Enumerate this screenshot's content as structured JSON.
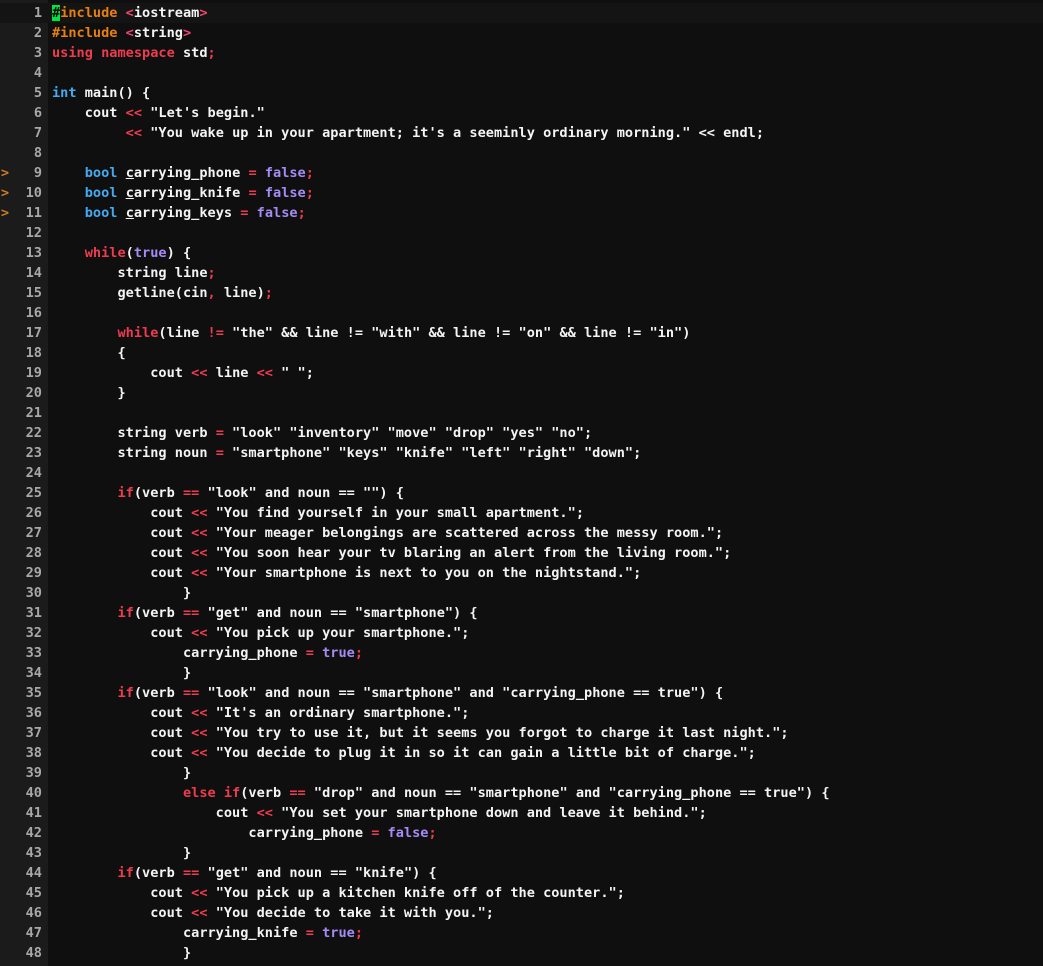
{
  "editor": {
    "colors": {
      "background": "#0f0f0f",
      "gutter": "#1b1b1b",
      "preprocessor": "#e8800f",
      "keyword": "#ee3c4f",
      "type": "#45a9f0",
      "boolean": "#a58bf5",
      "text": "#f4f4f4",
      "cursor": "#00e640"
    },
    "lines": [
      {
        "num": "1",
        "marker": "",
        "current": true,
        "tokens": [
          {
            "c": "cursor-block",
            "t": "#"
          },
          {
            "c": "pre",
            "t": "include "
          },
          {
            "c": "brk",
            "t": "<"
          },
          {
            "c": "plain",
            "t": "iostream"
          },
          {
            "c": "brk",
            "t": ">"
          }
        ]
      },
      {
        "num": "2",
        "marker": "",
        "tokens": [
          {
            "c": "pre",
            "t": "#include "
          },
          {
            "c": "brk",
            "t": "<"
          },
          {
            "c": "plain",
            "t": "string"
          },
          {
            "c": "brk",
            "t": ">"
          }
        ]
      },
      {
        "num": "3",
        "marker": "",
        "tokens": [
          {
            "c": "kw",
            "t": "using namespace"
          },
          {
            "c": "plain",
            "t": " std"
          },
          {
            "c": "semi",
            "t": ";"
          }
        ]
      },
      {
        "num": "4",
        "marker": "",
        "tokens": []
      },
      {
        "num": "5",
        "marker": "",
        "tokens": [
          {
            "c": "type",
            "t": "int"
          },
          {
            "c": "plain",
            "t": " main() {"
          }
        ]
      },
      {
        "num": "6",
        "marker": "",
        "tokens": [
          {
            "c": "plain",
            "t": "    cout "
          },
          {
            "c": "op",
            "t": "<<"
          },
          {
            "c": "str",
            "t": " \"Let's begin.\""
          }
        ]
      },
      {
        "num": "7",
        "marker": "",
        "tokens": [
          {
            "c": "plain",
            "t": "         "
          },
          {
            "c": "op",
            "t": "<<"
          },
          {
            "c": "str",
            "t": " \"You wake up in your apartment; it's a seeminly ordinary morning.\""
          },
          {
            "c": "plain",
            "t": " << endl;"
          }
        ]
      },
      {
        "num": "8",
        "marker": "",
        "tokens": []
      },
      {
        "num": "9",
        "marker": ">",
        "tokens": [
          {
            "c": "plain",
            "t": "    "
          },
          {
            "c": "type",
            "t": "bool"
          },
          {
            "c": "plain",
            "t": " "
          },
          {
            "c": "plain uline",
            "t": "c"
          },
          {
            "c": "plain",
            "t": "arrying_phone "
          },
          {
            "c": "op",
            "t": "="
          },
          {
            "c": "bool",
            "t": " false"
          },
          {
            "c": "semi",
            "t": ";"
          }
        ]
      },
      {
        "num": "10",
        "marker": ">",
        "tokens": [
          {
            "c": "plain",
            "t": "    "
          },
          {
            "c": "type",
            "t": "bool"
          },
          {
            "c": "plain",
            "t": " "
          },
          {
            "c": "plain uline",
            "t": "c"
          },
          {
            "c": "plain",
            "t": "arrying_knife "
          },
          {
            "c": "op",
            "t": "="
          },
          {
            "c": "bool",
            "t": " false"
          },
          {
            "c": "semi",
            "t": ";"
          }
        ]
      },
      {
        "num": "11",
        "marker": ">",
        "tokens": [
          {
            "c": "plain",
            "t": "    "
          },
          {
            "c": "type",
            "t": "bool"
          },
          {
            "c": "plain",
            "t": " "
          },
          {
            "c": "plain uline",
            "t": "c"
          },
          {
            "c": "plain",
            "t": "arrying_keys "
          },
          {
            "c": "op",
            "t": "="
          },
          {
            "c": "bool",
            "t": " false"
          },
          {
            "c": "semi",
            "t": ";"
          }
        ]
      },
      {
        "num": "12",
        "marker": "",
        "tokens": []
      },
      {
        "num": "13",
        "marker": "",
        "tokens": [
          {
            "c": "plain",
            "t": "    "
          },
          {
            "c": "kw",
            "t": "while"
          },
          {
            "c": "plain",
            "t": "("
          },
          {
            "c": "bool",
            "t": "true"
          },
          {
            "c": "plain",
            "t": ") {"
          }
        ]
      },
      {
        "num": "14",
        "marker": "",
        "tokens": [
          {
            "c": "plain",
            "t": "        string line"
          },
          {
            "c": "semi",
            "t": ";"
          }
        ]
      },
      {
        "num": "15",
        "marker": "",
        "tokens": [
          {
            "c": "plain",
            "t": "        getline(cin"
          },
          {
            "c": "semi",
            "t": ","
          },
          {
            "c": "plain",
            "t": " line)"
          },
          {
            "c": "semi",
            "t": ";"
          }
        ]
      },
      {
        "num": "16",
        "marker": "",
        "tokens": []
      },
      {
        "num": "17",
        "marker": "",
        "tokens": [
          {
            "c": "plain",
            "t": "        "
          },
          {
            "c": "kw",
            "t": "while"
          },
          {
            "c": "plain",
            "t": "(line "
          },
          {
            "c": "op",
            "t": "!="
          },
          {
            "c": "str",
            "t": " \"the\""
          },
          {
            "c": "plain",
            "t": " && line != \"with\" && line != \"on\" && line != \"in\")"
          }
        ]
      },
      {
        "num": "18",
        "marker": "",
        "tokens": [
          {
            "c": "plain",
            "t": "        {"
          }
        ]
      },
      {
        "num": "19",
        "marker": "",
        "tokens": [
          {
            "c": "plain",
            "t": "            cout "
          },
          {
            "c": "op",
            "t": "<<"
          },
          {
            "c": "plain",
            "t": " line "
          },
          {
            "c": "op",
            "t": "<<"
          },
          {
            "c": "str",
            "t": " \" \""
          },
          {
            "c": "plain",
            "t": ";"
          }
        ]
      },
      {
        "num": "20",
        "marker": "",
        "tokens": [
          {
            "c": "plain",
            "t": "        }"
          }
        ]
      },
      {
        "num": "21",
        "marker": "",
        "tokens": []
      },
      {
        "num": "22",
        "marker": "",
        "tokens": [
          {
            "c": "plain",
            "t": "        string verb "
          },
          {
            "c": "op",
            "t": "="
          },
          {
            "c": "str",
            "t": " \"look\" \"inventory\" \"move\" \"drop\" \"yes\" \"no\""
          },
          {
            "c": "plain",
            "t": ";"
          }
        ]
      },
      {
        "num": "23",
        "marker": "",
        "tokens": [
          {
            "c": "plain",
            "t": "        string noun "
          },
          {
            "c": "op",
            "t": "="
          },
          {
            "c": "str",
            "t": " \"smartphone\" \"keys\" \"knife\" \"left\" \"right\" \"down\""
          },
          {
            "c": "plain",
            "t": ";"
          }
        ]
      },
      {
        "num": "24",
        "marker": "",
        "tokens": []
      },
      {
        "num": "25",
        "marker": "",
        "tokens": [
          {
            "c": "plain",
            "t": "        "
          },
          {
            "c": "kw",
            "t": "if"
          },
          {
            "c": "plain",
            "t": "(verb "
          },
          {
            "c": "op",
            "t": "=="
          },
          {
            "c": "str",
            "t": " \"look\""
          },
          {
            "c": "plain",
            "t": " and noun == \"\") {"
          }
        ]
      },
      {
        "num": "26",
        "marker": "",
        "tokens": [
          {
            "c": "plain",
            "t": "            cout "
          },
          {
            "c": "op",
            "t": "<<"
          },
          {
            "c": "str",
            "t": " \"You find yourself in your small apartment.\""
          },
          {
            "c": "plain",
            "t": ";"
          }
        ]
      },
      {
        "num": "27",
        "marker": "",
        "tokens": [
          {
            "c": "plain",
            "t": "            cout "
          },
          {
            "c": "op",
            "t": "<<"
          },
          {
            "c": "str",
            "t": " \"Your meager belongings are scattered across the messy room.\""
          },
          {
            "c": "plain",
            "t": ";"
          }
        ]
      },
      {
        "num": "28",
        "marker": "",
        "tokens": [
          {
            "c": "plain",
            "t": "            cout "
          },
          {
            "c": "op",
            "t": "<<"
          },
          {
            "c": "str",
            "t": " \"You soon hear your tv blaring an alert from the living room.\""
          },
          {
            "c": "plain",
            "t": ";"
          }
        ]
      },
      {
        "num": "29",
        "marker": "",
        "tokens": [
          {
            "c": "plain",
            "t": "            cout "
          },
          {
            "c": "op",
            "t": "<<"
          },
          {
            "c": "str",
            "t": " \"Your smartphone is next to you on the nightstand.\""
          },
          {
            "c": "plain",
            "t": ";"
          }
        ]
      },
      {
        "num": "30",
        "marker": "",
        "tokens": [
          {
            "c": "plain",
            "t": "                }"
          }
        ]
      },
      {
        "num": "31",
        "marker": "",
        "tokens": [
          {
            "c": "plain",
            "t": "        "
          },
          {
            "c": "kw",
            "t": "if"
          },
          {
            "c": "plain",
            "t": "(verb "
          },
          {
            "c": "op",
            "t": "=="
          },
          {
            "c": "str",
            "t": " \"get\""
          },
          {
            "c": "plain",
            "t": " and noun == \"smartphone\") {"
          }
        ]
      },
      {
        "num": "32",
        "marker": "",
        "tokens": [
          {
            "c": "plain",
            "t": "            cout "
          },
          {
            "c": "op",
            "t": "<<"
          },
          {
            "c": "str",
            "t": " \"You pick up your smartphone.\""
          },
          {
            "c": "plain",
            "t": ";"
          }
        ]
      },
      {
        "num": "33",
        "marker": "",
        "tokens": [
          {
            "c": "plain",
            "t": "                carrying_phone "
          },
          {
            "c": "op",
            "t": "="
          },
          {
            "c": "bool",
            "t": " true"
          },
          {
            "c": "semi",
            "t": ";"
          }
        ]
      },
      {
        "num": "34",
        "marker": "",
        "tokens": [
          {
            "c": "plain",
            "t": "                }"
          }
        ]
      },
      {
        "num": "35",
        "marker": "",
        "tokens": [
          {
            "c": "plain",
            "t": "        "
          },
          {
            "c": "kw",
            "t": "if"
          },
          {
            "c": "plain",
            "t": "(verb "
          },
          {
            "c": "op",
            "t": "=="
          },
          {
            "c": "str",
            "t": " \"look\""
          },
          {
            "c": "plain",
            "t": " and noun == \"smartphone\" and \"carrying_phone == true\") {"
          }
        ]
      },
      {
        "num": "36",
        "marker": "",
        "tokens": [
          {
            "c": "plain",
            "t": "            cout "
          },
          {
            "c": "op",
            "t": "<<"
          },
          {
            "c": "str",
            "t": " \"It's an ordinary smartphone.\""
          },
          {
            "c": "plain",
            "t": ";"
          }
        ]
      },
      {
        "num": "37",
        "marker": "",
        "tokens": [
          {
            "c": "plain",
            "t": "            cout "
          },
          {
            "c": "op",
            "t": "<<"
          },
          {
            "c": "str",
            "t": " \"You try to use it, but it seems you forgot to charge it last night.\""
          },
          {
            "c": "plain",
            "t": ";"
          }
        ]
      },
      {
        "num": "38",
        "marker": "",
        "tokens": [
          {
            "c": "plain",
            "t": "            cout "
          },
          {
            "c": "op",
            "t": "<<"
          },
          {
            "c": "str",
            "t": " \"You decide to plug it in so it can gain a little bit of charge.\""
          },
          {
            "c": "plain",
            "t": ";"
          }
        ]
      },
      {
        "num": "39",
        "marker": "",
        "tokens": [
          {
            "c": "plain",
            "t": "                }"
          }
        ]
      },
      {
        "num": "40",
        "marker": "",
        "tokens": [
          {
            "c": "plain",
            "t": "                "
          },
          {
            "c": "kw",
            "t": "else if"
          },
          {
            "c": "plain",
            "t": "(verb "
          },
          {
            "c": "op",
            "t": "=="
          },
          {
            "c": "str",
            "t": " \"drop\""
          },
          {
            "c": "plain",
            "t": " and noun == \"smartphone\" and \"carrying_phone == true\") {"
          }
        ]
      },
      {
        "num": "41",
        "marker": "",
        "tokens": [
          {
            "c": "plain",
            "t": "                    cout "
          },
          {
            "c": "op",
            "t": "<<"
          },
          {
            "c": "str",
            "t": " \"You set your smartphone down and leave it behind.\""
          },
          {
            "c": "plain",
            "t": ";"
          }
        ]
      },
      {
        "num": "42",
        "marker": "",
        "tokens": [
          {
            "c": "plain",
            "t": "                        carrying_phone "
          },
          {
            "c": "op",
            "t": "="
          },
          {
            "c": "bool",
            "t": " false"
          },
          {
            "c": "semi",
            "t": ";"
          }
        ]
      },
      {
        "num": "43",
        "marker": "",
        "tokens": [
          {
            "c": "plain",
            "t": "                }"
          }
        ]
      },
      {
        "num": "44",
        "marker": "",
        "tokens": [
          {
            "c": "plain",
            "t": "        "
          },
          {
            "c": "kw",
            "t": "if"
          },
          {
            "c": "plain",
            "t": "(verb "
          },
          {
            "c": "op",
            "t": "=="
          },
          {
            "c": "str",
            "t": " \"get\""
          },
          {
            "c": "plain",
            "t": " and noun == \"knife\") {"
          }
        ]
      },
      {
        "num": "45",
        "marker": "",
        "tokens": [
          {
            "c": "plain",
            "t": "            cout "
          },
          {
            "c": "op",
            "t": "<<"
          },
          {
            "c": "str",
            "t": " \"You pick up a kitchen knife off of the counter.\""
          },
          {
            "c": "plain",
            "t": ";"
          }
        ]
      },
      {
        "num": "46",
        "marker": "",
        "tokens": [
          {
            "c": "plain",
            "t": "            cout "
          },
          {
            "c": "op",
            "t": "<<"
          },
          {
            "c": "str",
            "t": " \"You decide to take it with you.\""
          },
          {
            "c": "plain",
            "t": ";"
          }
        ]
      },
      {
        "num": "47",
        "marker": "",
        "tokens": [
          {
            "c": "plain",
            "t": "                carrying_knife "
          },
          {
            "c": "op",
            "t": "="
          },
          {
            "c": "bool",
            "t": " true"
          },
          {
            "c": "semi",
            "t": ";"
          }
        ]
      },
      {
        "num": "48",
        "marker": "",
        "tokens": [
          {
            "c": "plain",
            "t": "                }"
          }
        ]
      }
    ]
  }
}
